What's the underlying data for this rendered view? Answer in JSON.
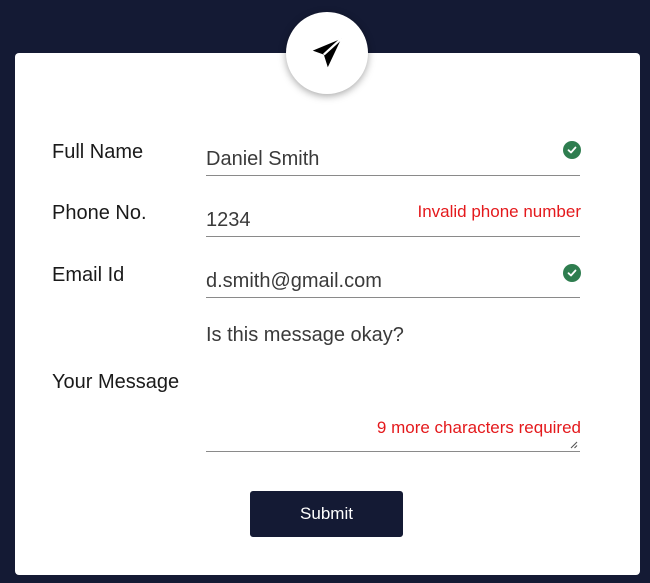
{
  "header": {
    "icon": "paper-plane-icon"
  },
  "form": {
    "full_name": {
      "label": "Full Name",
      "value": "Daniel Smith",
      "status": "valid"
    },
    "phone": {
      "label": "Phone No.",
      "value": "1234",
      "status": "invalid",
      "error": "Invalid phone number"
    },
    "email": {
      "label": "Email Id",
      "value": "d.smith@gmail.com",
      "status": "valid"
    },
    "message": {
      "label": "Your Message",
      "value": "Is this message okay?",
      "status": "invalid",
      "error": "9 more characters required"
    },
    "submit_label": "Submit"
  },
  "colors": {
    "background": "#141a34",
    "card": "#ffffff",
    "valid": "#2e7d4f",
    "error": "#e4191c",
    "button": "#141a34"
  }
}
